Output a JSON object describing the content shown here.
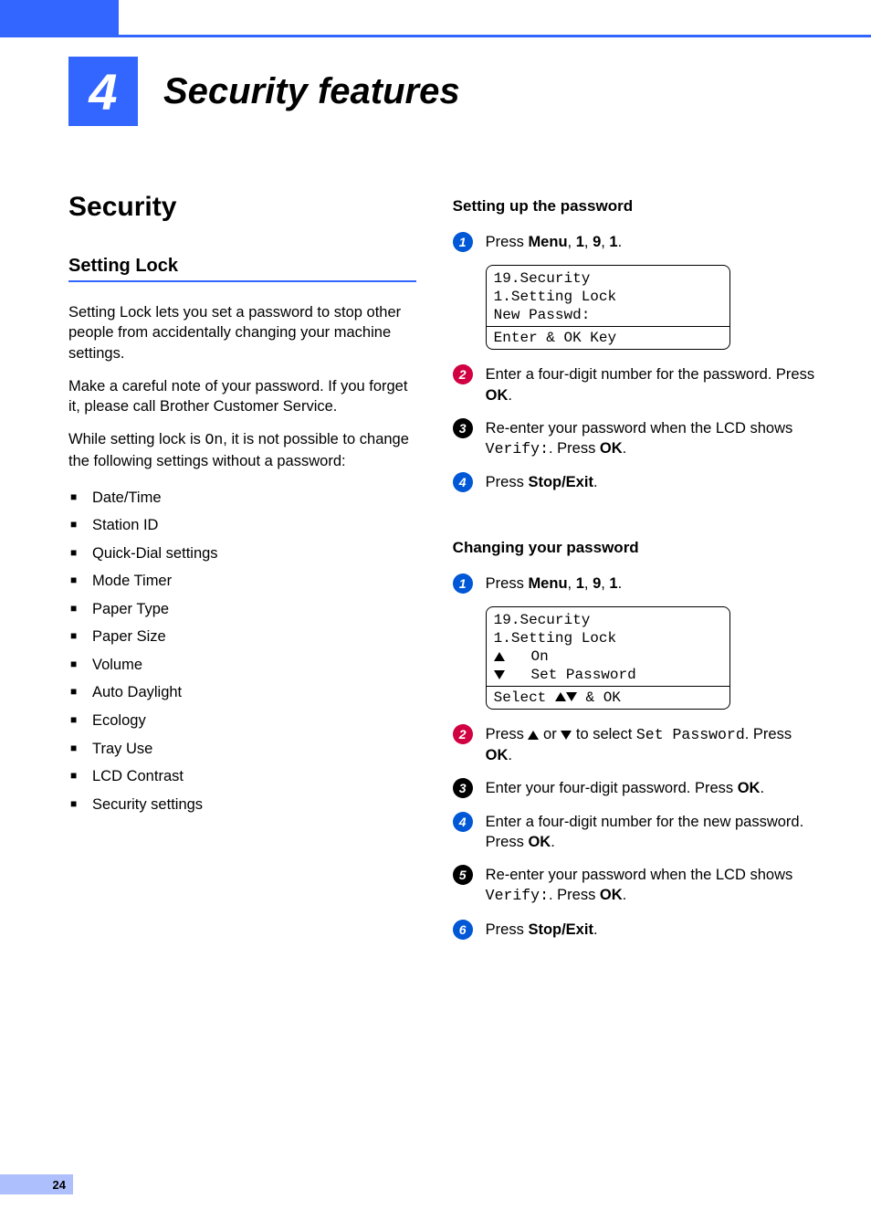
{
  "page": {
    "number": "24"
  },
  "chapter": {
    "number": "4",
    "title": "Security features"
  },
  "left": {
    "section_title": "Security",
    "subsection": "Setting Lock",
    "para1": "Setting Lock lets you set a password to stop other people from accidentally changing your machine settings.",
    "para2a": "Make a careful note of your password. If you forget it, please call Brother Customer Service.",
    "para3a": "While setting lock is ",
    "para3_mono": "On",
    "para3b": ", it is not possible to change the following settings without a password:",
    "list": [
      "Date/Time",
      "Station ID",
      "Quick-Dial settings",
      "Mode Timer",
      "Paper Type",
      "Paper Size",
      "Volume",
      "Auto Daylight",
      "Ecology",
      "Tray Use",
      "LCD Contrast",
      "Security settings"
    ]
  },
  "right": {
    "setup": {
      "heading": "Setting up the password",
      "steps": {
        "s1a": "Press ",
        "s1_menu": "Menu",
        "s1b": ", ",
        "s1_1": "1",
        "s1c": ", ",
        "s1_9": "9",
        "s1d": ", ",
        "s1_1b": "1",
        "s1e": ".",
        "lcd": {
          "l1": "19.Security",
          "l2": "  1.Setting Lock",
          "l3": " ",
          "l4": "  New Passwd:",
          "l5": "Enter & OK Key"
        },
        "s2a": "Enter a four-digit number for the password. Press ",
        "s2_ok": "OK",
        "s2b": ".",
        "s3a": "Re-enter your password when the LCD shows ",
        "s3_mono": "Verify:",
        "s3b": ". Press ",
        "s3_ok": "OK",
        "s3c": ".",
        "s4a": "Press ",
        "s4_stop": "Stop/Exit",
        "s4b": "."
      }
    },
    "change": {
      "heading": "Changing your password",
      "steps": {
        "s1a": "Press ",
        "s1_menu": "Menu",
        "s1b": ", ",
        "s1_1": "1",
        "s1c": ", ",
        "s1_9": "9",
        "s1d": ", ",
        "s1_1b": "1",
        "s1e": ".",
        "lcd": {
          "l1": "19.Security",
          "l2": "  1.Setting Lock",
          "l3": "On",
          "l4": "Set Password",
          "l5": "Select ",
          "l5b": " & OK"
        },
        "s2a": "Press ",
        "s2_or": " or ",
        "s2b": " to select ",
        "s2_mono": "Set Password",
        "s2c": ". Press ",
        "s2_ok": "OK",
        "s2d": ".",
        "s3a": "Enter your four-digit password. Press ",
        "s3_ok": "OK",
        "s3b": ".",
        "s4a": "Enter a four-digit number for the new password. Press ",
        "s4_ok": "OK",
        "s4b": ".",
        "s5a": "Re-enter your password when the LCD shows ",
        "s5_mono": "Verify:",
        "s5b": ". Press ",
        "s5_ok": "OK",
        "s5c": ".",
        "s6a": "Press ",
        "s6_stop": "Stop/Exit",
        "s6b": "."
      }
    }
  }
}
